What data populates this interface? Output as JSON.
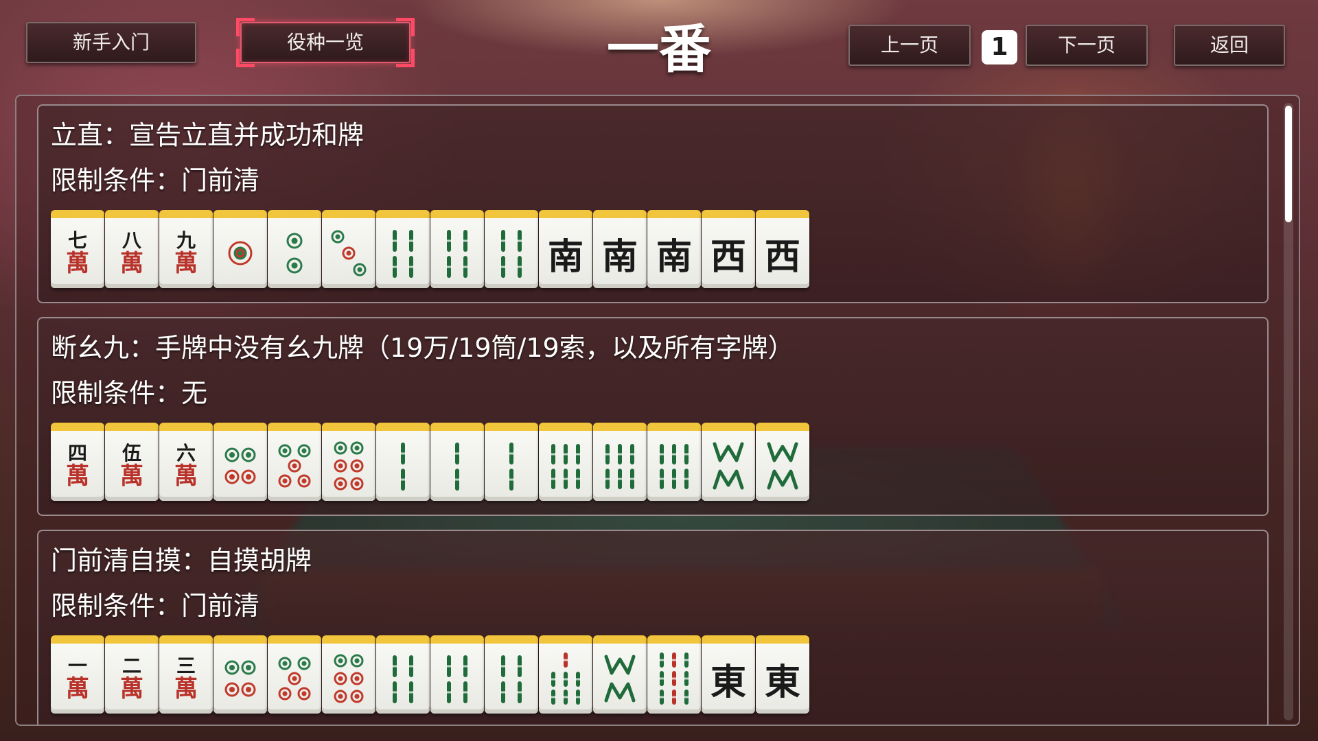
{
  "header": {
    "beginner_label": "新手入门",
    "yaku_list_label": "役种一览",
    "title": "一番",
    "prev_label": "上一页",
    "page_number": "1",
    "next_label": "下一页",
    "back_label": "返回"
  },
  "yaku": [
    {
      "name": "立直：宣告立直并成功和牌",
      "limit": "限制条件：门前清",
      "tiles": [
        {
          "kind": "man",
          "num": "七"
        },
        {
          "kind": "man",
          "num": "八"
        },
        {
          "kind": "man",
          "num": "九"
        },
        {
          "kind": "pin",
          "n": 1
        },
        {
          "kind": "pin",
          "n": 2
        },
        {
          "kind": "pin",
          "n": 3
        },
        {
          "kind": "sou",
          "n": 4
        },
        {
          "kind": "sou",
          "n": 4
        },
        {
          "kind": "sou",
          "n": 4
        },
        {
          "kind": "honor",
          "ch": "南"
        },
        {
          "kind": "honor",
          "ch": "南"
        },
        {
          "kind": "honor",
          "ch": "南"
        },
        {
          "kind": "honor",
          "ch": "西"
        },
        {
          "kind": "honor",
          "ch": "西"
        }
      ]
    },
    {
      "name": "断幺九：手牌中没有幺九牌（19万/19筒/19索，以及所有字牌）",
      "limit": "限制条件：无",
      "tiles": [
        {
          "kind": "man",
          "num": "四"
        },
        {
          "kind": "man",
          "num": "伍"
        },
        {
          "kind": "man",
          "num": "六"
        },
        {
          "kind": "pin",
          "n": 4
        },
        {
          "kind": "pin",
          "n": 5
        },
        {
          "kind": "pin",
          "n": 6
        },
        {
          "kind": "sou",
          "n": 2
        },
        {
          "kind": "sou",
          "n": 2
        },
        {
          "kind": "sou",
          "n": 2
        },
        {
          "kind": "sou",
          "n": 6
        },
        {
          "kind": "sou",
          "n": 6
        },
        {
          "kind": "sou",
          "n": 6
        },
        {
          "kind": "sou",
          "n": 8
        },
        {
          "kind": "sou",
          "n": 8
        }
      ]
    },
    {
      "name": "门前清自摸：自摸胡牌",
      "limit": "限制条件：门前清",
      "tiles": [
        {
          "kind": "man",
          "num": "一"
        },
        {
          "kind": "man",
          "num": "二"
        },
        {
          "kind": "man",
          "num": "三"
        },
        {
          "kind": "pin",
          "n": 4
        },
        {
          "kind": "pin",
          "n": 5
        },
        {
          "kind": "pin",
          "n": 6
        },
        {
          "kind": "sou",
          "n": 4
        },
        {
          "kind": "sou",
          "n": 4
        },
        {
          "kind": "sou",
          "n": 4
        },
        {
          "kind": "sou",
          "n": 7
        },
        {
          "kind": "sou",
          "n": 8
        },
        {
          "kind": "sou",
          "n": 9
        },
        {
          "kind": "honor",
          "ch": "東"
        },
        {
          "kind": "honor",
          "ch": "東"
        }
      ]
    }
  ],
  "man_suffix": "萬",
  "colors": {
    "tile_top": "#f1c53c",
    "man_red": "#b8322a",
    "bamboo_green": "#1f6b3a",
    "dot_green": "#2a7a4a",
    "dot_red": "#c0392b",
    "highlight": "#ff4a66"
  }
}
